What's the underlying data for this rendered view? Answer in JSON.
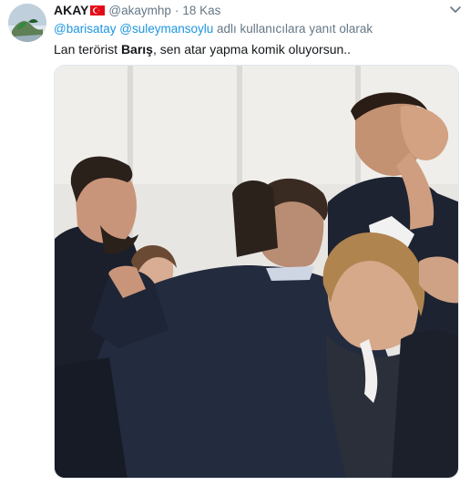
{
  "tweet": {
    "display_name": "AKAY",
    "handle": "@akaymhp",
    "separator": "·",
    "time": "18 Kas",
    "reply_to": {
      "mentions": [
        "@barisatay",
        "@suleymansoylu"
      ],
      "suffix": "adlı kullanıcılara yanıt olarak"
    },
    "text": {
      "before": "Lan terörist ",
      "bold": "Barış",
      "after": ", sen atar yapma komik oluyorsun.."
    },
    "flag_icon": "turkey-flag-icon",
    "menu_icon": "chevron-down-icon"
  },
  "colors": {
    "link": "#1b95e0",
    "secondary_text": "#657786",
    "primary_text": "#14171a",
    "flag_red": "#e30a17"
  }
}
